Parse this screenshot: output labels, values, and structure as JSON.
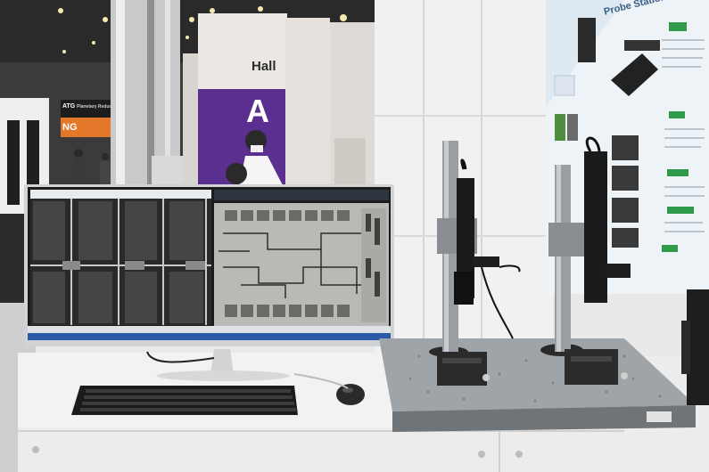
{
  "booth": {
    "hall_sign": "Hall",
    "hall_letter": "A",
    "left_sign_line1": "ATG",
    "left_sign_line2": "Planetary Reduc",
    "orange_banner": "NG"
  },
  "poster": {
    "title": "Probe Station",
    "colors": {
      "accent": "#2e9a4a",
      "bg": "#eef3f7"
    }
  },
  "monitor": {
    "left_pane": "chip-grid-image",
    "right_pane": "circuit-layout-image",
    "taskbar_color": "#2a5aa8"
  },
  "colors": {
    "purple": "#5a2f8f",
    "table": "#f2f2f2",
    "optical_table": "#b8bcc0",
    "post": "#9a9ea3"
  }
}
